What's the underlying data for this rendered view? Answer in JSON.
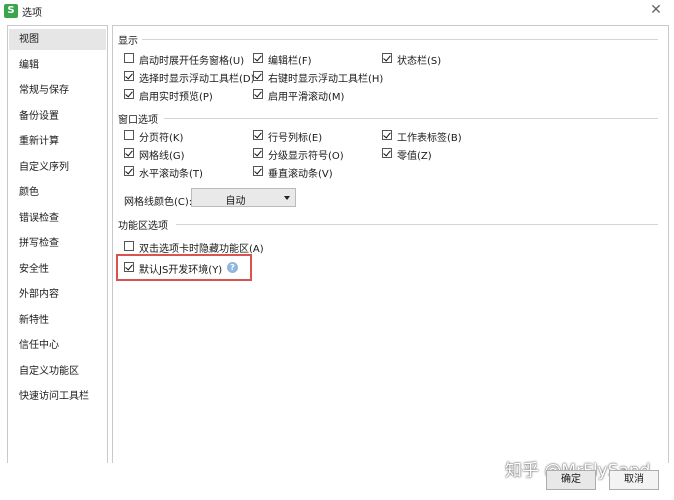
{
  "window": {
    "title": "选项",
    "app_icon": "S"
  },
  "sidebar": {
    "items": [
      {
        "label": "视图",
        "active": true
      },
      {
        "label": "编辑"
      },
      {
        "label": "常规与保存"
      },
      {
        "label": "备份设置"
      },
      {
        "label": "重新计算"
      },
      {
        "label": "自定义序列"
      },
      {
        "label": "颜色"
      },
      {
        "label": "错误检查"
      },
      {
        "label": "拼写检查"
      },
      {
        "label": "安全性"
      },
      {
        "label": "外部内容"
      },
      {
        "label": "新特性"
      },
      {
        "label": "信任中心"
      },
      {
        "label": "自定义功能区"
      },
      {
        "label": "快速访问工具栏"
      }
    ]
  },
  "display": {
    "title": "显示",
    "options": [
      {
        "label": "启动时展开任务窗格(U)",
        "checked": false
      },
      {
        "label": "编辑栏(F)",
        "checked": true
      },
      {
        "label": "状态栏(S)",
        "checked": true
      },
      {
        "label": "选择时显示浮动工具栏(D)",
        "checked": true
      },
      {
        "label": "右键时显示浮动工具栏(H)",
        "checked": true
      },
      {
        "label": "启用实时预览(P)",
        "checked": true
      },
      {
        "label": "启用平滑滚动(M)",
        "checked": true
      }
    ]
  },
  "window_options": {
    "title": "窗口选项",
    "options": [
      {
        "label": "分页符(K)",
        "checked": false
      },
      {
        "label": "行号列标(E)",
        "checked": true
      },
      {
        "label": "工作表标签(B)",
        "checked": true
      },
      {
        "label": "网格线(G)",
        "checked": true
      },
      {
        "label": "分级显示符号(O)",
        "checked": true
      },
      {
        "label": "零值(Z)",
        "checked": true
      },
      {
        "label": "水平滚动条(T)",
        "checked": true
      },
      {
        "label": "垂直滚动条(V)",
        "checked": true
      }
    ],
    "gridline_color_label": "网格线颜色(C):",
    "gridline_color_value": "自动"
  },
  "ribbon": {
    "title": "功能区选项",
    "options": [
      {
        "label": "双击选项卡时隐藏功能区(A)",
        "checked": false
      },
      {
        "label": "默认JS开发环境(Y)",
        "checked": true
      }
    ],
    "help_icon": "question-circle-icon",
    "highlight_color": "#d9534f"
  },
  "buttons": {
    "ok": "确定",
    "cancel": "取消"
  },
  "watermark": "知乎 @MrFlySand"
}
